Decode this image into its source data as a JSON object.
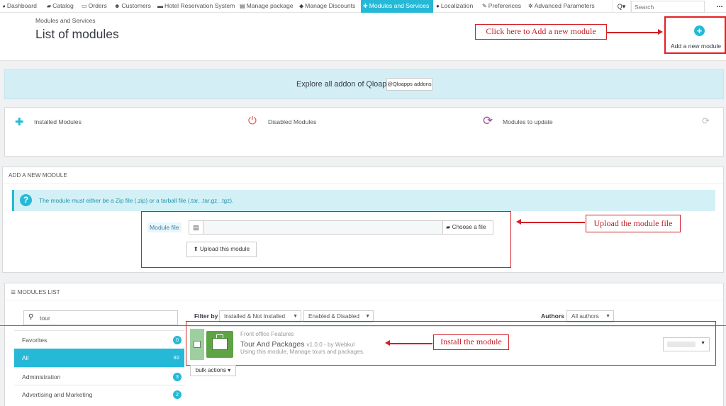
{
  "nav": {
    "items": [
      {
        "label": "Dashboard",
        "icon": "dashboard-icon",
        "glyph": "◕"
      },
      {
        "label": "Catalog",
        "icon": "catalog-icon",
        "glyph": "▰"
      },
      {
        "label": "Orders",
        "icon": "orders-icon",
        "glyph": "▭"
      },
      {
        "label": "Customers",
        "icon": "customers-icon",
        "glyph": "☻"
      },
      {
        "label": "Hotel Reservation System",
        "icon": "bed-icon",
        "glyph": "▬"
      },
      {
        "label": "Manage package",
        "icon": "package-icon",
        "glyph": "▤"
      },
      {
        "label": "Manage Discounts",
        "icon": "tag-icon",
        "glyph": "◆"
      },
      {
        "label": "Modules and Services",
        "icon": "puzzle-icon",
        "glyph": "✚"
      },
      {
        "label": "Localization",
        "icon": "globe-icon",
        "glyph": "●"
      },
      {
        "label": "Preferences",
        "icon": "wrench-icon",
        "glyph": "✎"
      },
      {
        "label": "Advanced Parameters",
        "icon": "cogs-icon",
        "glyph": "✲"
      }
    ],
    "search_placeholder": "Search",
    "search_toggle": "Q▾",
    "more": "..."
  },
  "header": {
    "breadcrumb": "Modules and Services",
    "title": "List of modules",
    "add_button_label": "Add a new module"
  },
  "annotations": {
    "add_module": "Click here to Add a new module",
    "upload": "Upload the module file",
    "install": "Install the module"
  },
  "banner": {
    "text": "Explore all addon of Qloapps",
    "button": "@Qloapps addons"
  },
  "kpis": [
    {
      "label": "Installed Modules",
      "icon": "puzzle-icon",
      "glyph": "✚",
      "color": "#25b9d7"
    },
    {
      "label": "Disabled Modules",
      "icon": "power-icon",
      "glyph": "⏻",
      "color": "#e84e4e"
    },
    {
      "label": "Modules to update",
      "icon": "refresh-icon",
      "glyph": "⟳",
      "color": "#a0509e"
    }
  ],
  "add_module_panel": {
    "heading": "Add a new module",
    "info": "The module must either be a Zip file (.zip) or a tarball file (.tar, .tar.gz, .tgz).",
    "file_label": "Module file",
    "choose_label": "Choose a file",
    "upload_label": "Upload this module"
  },
  "modules_list": {
    "heading": "Modules list",
    "search_value": "tour",
    "categories": [
      {
        "label": "Favorites",
        "count": "0"
      },
      {
        "label": "All",
        "count": "92"
      },
      {
        "label": "Administration",
        "count": "3"
      },
      {
        "label": "Advertising and Marketing",
        "count": "2"
      }
    ],
    "filter_label": "Filter by",
    "filter_install": "Installed & Not Installed",
    "filter_enabled": "Enabled & Disabled",
    "authors_label": "Authors",
    "authors_value": "All authors",
    "module": {
      "category": "Front office Features",
      "name": "Tour And Packages",
      "version": "v1.0.0 - by Webkul",
      "description": "Using this module, Manage tours and packages."
    },
    "bulk_label": "bulk actions ▾"
  },
  "colors": {
    "accent": "#25b9d7",
    "annotation": "#d32027"
  }
}
